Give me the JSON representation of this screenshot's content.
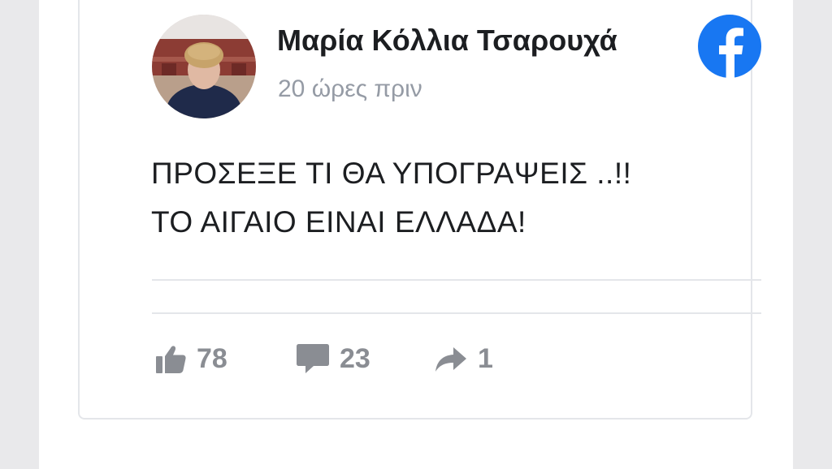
{
  "post": {
    "author_name": "Μαρία Κόλλια Τσαρουχά",
    "timestamp": "20 ώρες πριν",
    "text_line_1": "ΠΡΟΣΕΞΕ ΤΙ ΘΑ ΥΠΟΓΡΑΨΕΙΣ ..!!",
    "text_line_2": "ΤΟ ΑΙΓΑΙΟ ΕΙΝΑΙ ΕΛΛΑΔΑ!"
  },
  "stats": {
    "likes": "78",
    "comments": "23",
    "shares": "1"
  },
  "icons": {
    "platform": "facebook-icon",
    "like": "thumbs-up-icon",
    "comment": "speech-bubble-icon",
    "share": "share-arrow-icon"
  },
  "colors": {
    "facebook_blue": "#1877f2",
    "text": "#1c1e21",
    "muted": "#8a8d93"
  }
}
